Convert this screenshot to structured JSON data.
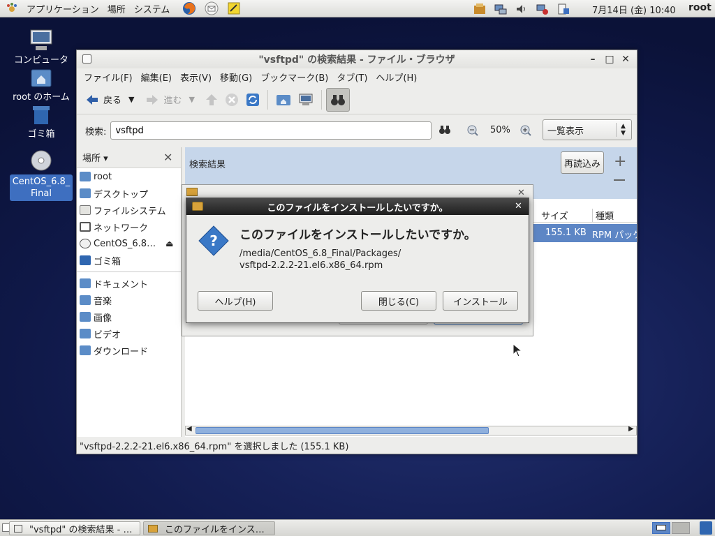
{
  "top_panel": {
    "menus": [
      "アプリケーション",
      "場所",
      "システム"
    ],
    "launchers": [
      "firefox-icon",
      "mail-icon",
      "notes-icon"
    ],
    "tray_icons": [
      "update-icon",
      "network-icon",
      "volume-icon",
      "network-alert-icon",
      "clipboard-icon"
    ],
    "clock": "7月14日 (金) 10:40",
    "user": "root"
  },
  "desktop": {
    "icons": [
      {
        "label": "コンピュータ",
        "icon": "computer-icon"
      },
      {
        "label": "root のホーム",
        "icon": "home-folder-icon"
      },
      {
        "label": "ゴミ箱",
        "icon": "trash-icon"
      },
      {
        "label": "CentOS_6.8_\nFinal",
        "icon": "cd-icon",
        "selected": true
      }
    ]
  },
  "window": {
    "title": "\"vsftpd\" の検索結果 - ファイル・ブラウザ",
    "menubar": [
      "ファイル(F)",
      "編集(E)",
      "表示(V)",
      "移動(G)",
      "ブックマーク(B)",
      "タブ(T)",
      "ヘルプ(H)"
    ],
    "toolbar": {
      "back": "戻る",
      "forward": "進む"
    },
    "search": {
      "label": "検索:",
      "value": "vsftpd"
    },
    "zoom": "50%",
    "view_mode": "一覧表示",
    "sidebar": {
      "header": "場所",
      "places": [
        {
          "label": "root",
          "icon": "home-folder-icon"
        },
        {
          "label": "デスクトップ",
          "icon": "desktop-folder-icon"
        },
        {
          "label": "ファイルシステム",
          "icon": "drive-icon"
        },
        {
          "label": "ネットワーク",
          "icon": "network-icon"
        },
        {
          "label": "CentOS_6.8…",
          "icon": "cd-icon"
        },
        {
          "label": "ゴミ箱",
          "icon": "trash-icon"
        }
      ],
      "bookmarks": [
        {
          "label": "ドキュメント",
          "icon": "folder-icon"
        },
        {
          "label": "音楽",
          "icon": "folder-icon"
        },
        {
          "label": "画像",
          "icon": "folder-icon"
        },
        {
          "label": "ビデオ",
          "icon": "folder-icon"
        },
        {
          "label": "ダウンロード",
          "icon": "folder-icon"
        }
      ]
    },
    "results": {
      "header": "検索結果",
      "reload": "再読込み",
      "columns": {
        "size": "サイズ",
        "type": "種類"
      },
      "row": {
        "size": "155.1 KB",
        "type": "RPM パッケ"
      }
    },
    "status": "\"vsftpd-2.2.2-21.el6.x86_64.rpm\" を選択しました (155.1 KB)"
  },
  "dialog": {
    "title": "このファイルをインストールしたいですか。",
    "heading": "このファイルをインストールしたいですか。",
    "path_line1": "/media/CentOS_6.8_Final/Packages/",
    "path_line2": "vsftpd-2.2.2-21.el6.x86_64.rpm",
    "help": "ヘルプ(H)",
    "close": "閉じる(C)",
    "install": "インストール"
  },
  "taskbar": {
    "tasks": [
      {
        "label": "\"vsftpd\" の検索結果 - …"
      },
      {
        "label": "このファイルをインス…",
        "active": true
      }
    ]
  },
  "colors": {
    "accent": "#3e6fc0",
    "selection": "#5d86c5",
    "panel": "#e6e6e2"
  }
}
